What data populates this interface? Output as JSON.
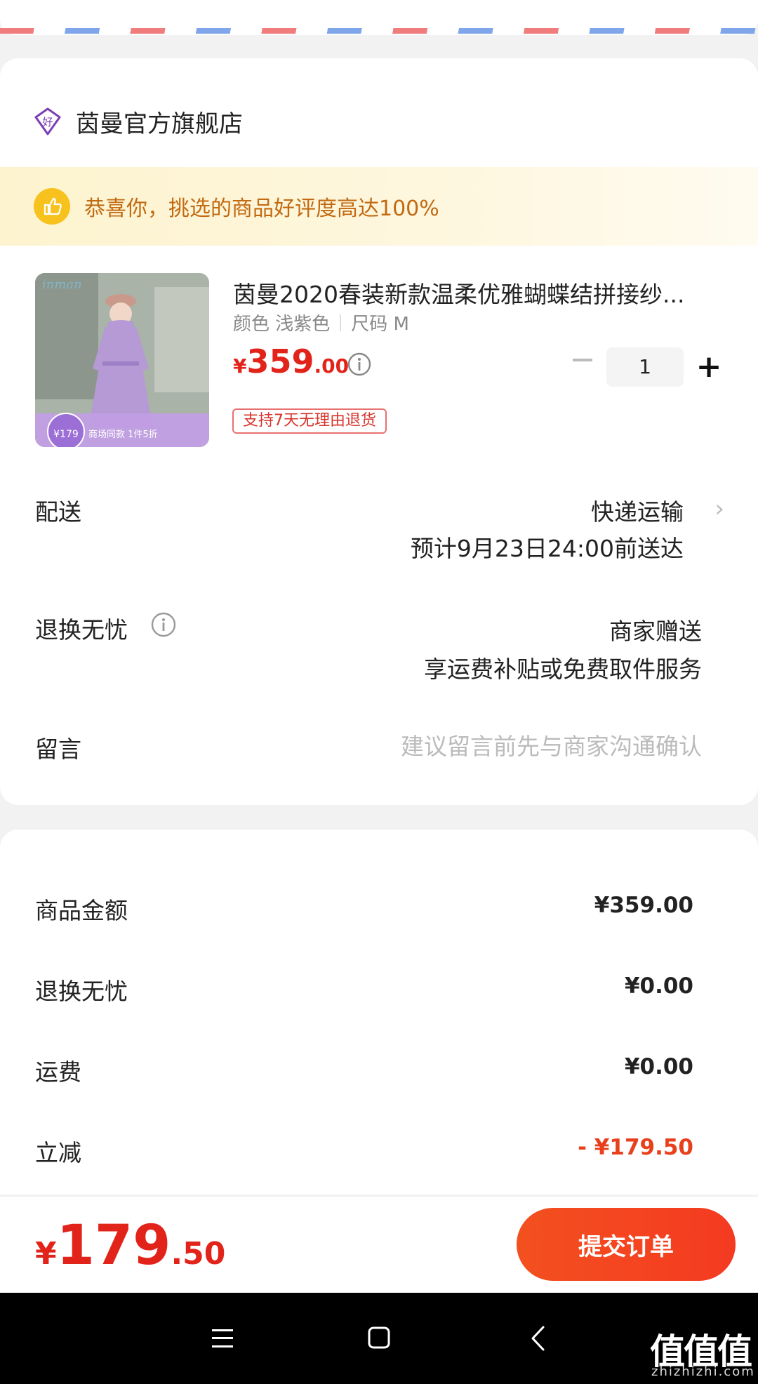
{
  "store": {
    "name": "茵曼官方旗舰店",
    "icon": "diamond-hao-icon",
    "icon_text": "好"
  },
  "promo": {
    "text": "恭喜你，挑选的商品好评度高达100%",
    "icon": "thumbs-up-icon"
  },
  "product": {
    "title": "茵曼2020春装新款温柔优雅蝴蝶结拼接纱...",
    "color": "颜色 浅紫色",
    "size": "尺码 M",
    "price_symbol": "¥",
    "price_int": "359",
    "price_dec": ".00",
    "return_badge": "支持7天无理由退货",
    "quantity": "1",
    "image": {
      "brand": "inman",
      "badge_price": "¥179",
      "badge_text": "商场同款 1件5折"
    }
  },
  "delivery": {
    "label": "配送",
    "method": "快递运输",
    "eta": "预计9月23日24:00前送达"
  },
  "return_service": {
    "label": "退换无忧",
    "line1": "商家赠送",
    "line2": "享运费补贴或免费取件服务"
  },
  "message": {
    "label": "留言",
    "placeholder": "建议留言前先与商家沟通确认",
    "value": ""
  },
  "summary": {
    "goods_label": "商品金额",
    "goods_value": "¥359.00",
    "return_label": "退换无忧",
    "return_value": "¥0.00",
    "shipping_label": "运费",
    "shipping_value": "¥0.00",
    "discount_label": "立减",
    "discount_value": "- ¥179.50"
  },
  "total": {
    "symbol": "¥",
    "int": "179",
    "dec": ".50"
  },
  "submit_label": "提交订单",
  "watermark": {
    "text": "值值值",
    "sub": "zhizhizhi.com"
  },
  "colors": {
    "accent": "#e2231a",
    "button": "#f43a21",
    "promo_text": "#c26a12",
    "promo_bg": "#fdf3cf"
  }
}
